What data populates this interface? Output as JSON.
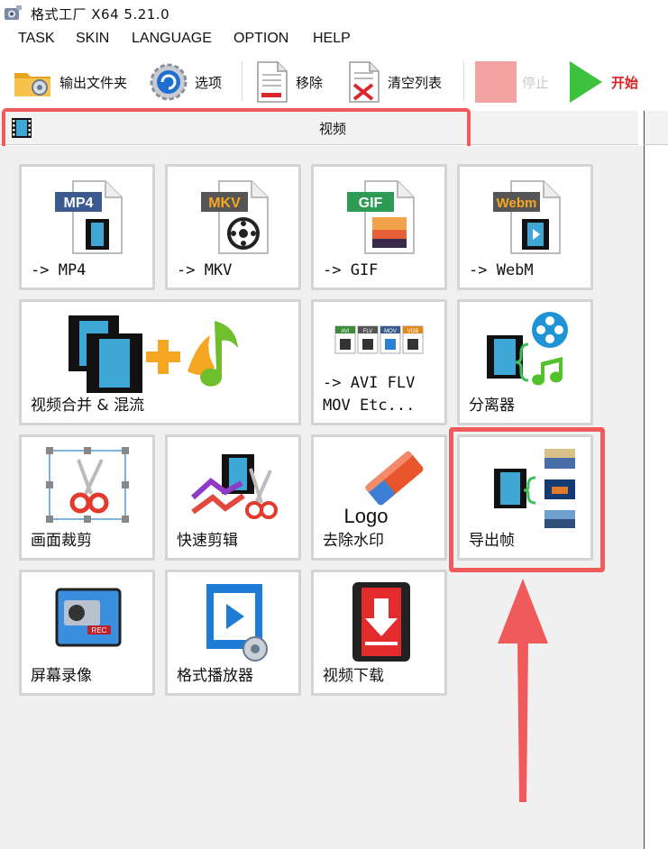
{
  "window": {
    "title": "格式工厂 X64 5.21.0"
  },
  "menu": {
    "items": [
      "TASK",
      "SKIN",
      "LANGUAGE",
      "OPTION",
      "HELP"
    ]
  },
  "toolbar": {
    "output_folder": "输出文件夹",
    "options": "选项",
    "remove": "移除",
    "clear_list": "清空列表",
    "stop": "停止",
    "start": "开始"
  },
  "category": {
    "label": "视频"
  },
  "tiles": {
    "mp4": {
      "badge": "MP4",
      "label": "-> MP4"
    },
    "mkv": {
      "badge": "MKV",
      "label": "-> MKV"
    },
    "gif": {
      "badge": "GIF",
      "label": "-> GIF"
    },
    "webm": {
      "badge": "Webm",
      "label": "-> WebM"
    },
    "merge": {
      "label": "视频合并 & 混流"
    },
    "avi": {
      "badges": [
        "AVI",
        "FLV",
        "MOV",
        "VOB"
      ],
      "label": "-> AVI FLV\nMOV Etc..."
    },
    "splitter": {
      "label": "分离器"
    },
    "crop": {
      "label": "画面裁剪"
    },
    "quick_cut": {
      "label": "快速剪辑"
    },
    "watermark": {
      "logo_text": "Logo",
      "label": "去除水印"
    },
    "export_frames": {
      "label": "导出帧"
    },
    "screen_record": {
      "badge": "REC",
      "label": "屏幕录像"
    },
    "player": {
      "label": "格式播放器"
    },
    "download": {
      "label": "视频下载"
    }
  },
  "colors": {
    "highlight": "#f05a5a",
    "start_green": "#3cc23c",
    "stop_pink": "#f4a3a3",
    "start_text": "#e02020"
  }
}
